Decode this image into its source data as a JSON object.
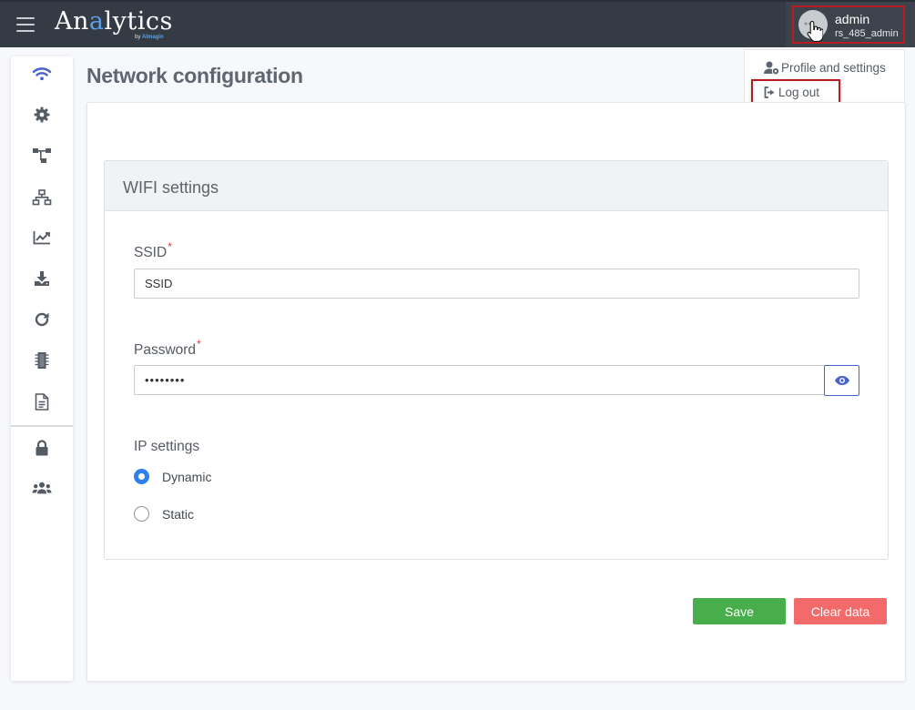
{
  "app": {
    "logo_main": "Analytics",
    "logo_prefix": "An",
    "logo_accent": "a",
    "logo_suffix": "lytics",
    "logo_sub_prefix": "by",
    "logo_sub_brand": "Almagin"
  },
  "user": {
    "name": "admin",
    "role": "rs_485_admin"
  },
  "user_menu": {
    "items": [
      {
        "label": "Profile and settings",
        "icon": "user-gear-icon"
      },
      {
        "label": "Log out",
        "icon": "sign-out-icon"
      }
    ]
  },
  "sidebar": {
    "items": [
      {
        "icon": "wifi-icon",
        "active": true
      },
      {
        "icon": "gear-icon"
      },
      {
        "icon": "network-tree-icon"
      },
      {
        "icon": "sitemap-icon"
      },
      {
        "icon": "chart-line-icon"
      },
      {
        "icon": "download-icon"
      },
      {
        "icon": "refresh-icon"
      },
      {
        "icon": "chip-icon"
      },
      {
        "icon": "document-icon"
      },
      {
        "icon": "lock-icon"
      },
      {
        "icon": "users-icon"
      }
    ]
  },
  "page": {
    "title": "Network configuration"
  },
  "wifi": {
    "title": "WIFI settings",
    "ssid_label": "SSID",
    "ssid_value": "SSID",
    "password_label": "Password",
    "password_value": "••••••••",
    "required_mark": "*",
    "ip_label": "IP settings",
    "ip_options": [
      {
        "label": "Dynamic",
        "selected": true
      },
      {
        "label": "Static",
        "selected": false
      }
    ]
  },
  "actions": {
    "save_label": "Save",
    "clear_label": "Clear data"
  },
  "colors": {
    "topbar": "#353b45",
    "accent_blue": "#2f80ed",
    "save_green": "#48ae4c",
    "clear_red": "#f26a6a",
    "highlight_red": "#b81c22",
    "icon_active": "#4a63c9",
    "icon_default": "#555b63"
  }
}
